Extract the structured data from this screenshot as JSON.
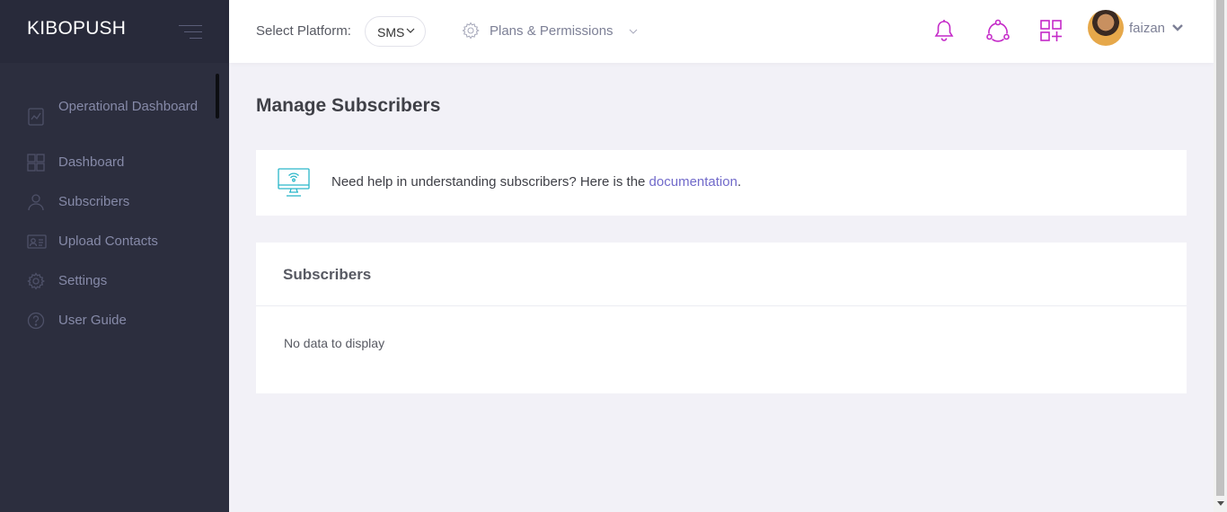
{
  "brand": {
    "name": "KIBOPUSH"
  },
  "sidebar": {
    "items": [
      {
        "label": "Operational Dashboard",
        "icon": "operational-dashboard-icon"
      },
      {
        "label": "Dashboard",
        "icon": "dashboard-grid-icon"
      },
      {
        "label": "Subscribers",
        "icon": "user-icon"
      },
      {
        "label": "Upload Contacts",
        "icon": "contact-card-icon"
      },
      {
        "label": "Settings",
        "icon": "gear-icon"
      },
      {
        "label": "User Guide",
        "icon": "question-icon"
      }
    ]
  },
  "header": {
    "platform_label": "Select Platform:",
    "platform_value": "SMS",
    "plans_label": "Plans & Permissions",
    "user_name": "faizan",
    "icons": [
      "bell-icon",
      "share-icon",
      "apps-add-icon"
    ],
    "accent_color": "#c429c8"
  },
  "main": {
    "title": "Manage Subscribers",
    "help": {
      "text": "Need help in understanding subscribers? Here is the ",
      "link": "documentation",
      "suffix": "."
    },
    "subscribers": {
      "title": "Subscribers",
      "empty": "No data to display"
    }
  }
}
